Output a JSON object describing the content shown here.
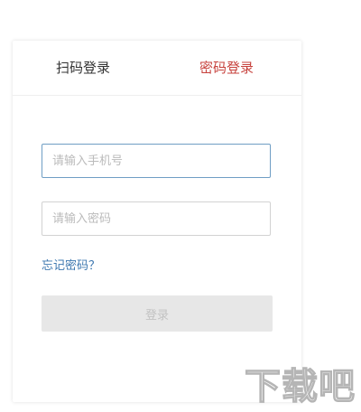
{
  "tabs": {
    "qr_login": "扫码登录",
    "password_login": "密码登录",
    "active": "password_login"
  },
  "form": {
    "phone_placeholder": "请输入手机号",
    "password_placeholder": "请输入密码",
    "forgot_password": "忘记密码？",
    "login_button": "登录"
  },
  "watermark": {
    "text": "下载吧"
  },
  "colors": {
    "active_tab": "#c7423d",
    "link": "#3e78b0",
    "focused_border": "#6f9ec4",
    "disabled_button_bg": "#e7e7e7"
  }
}
